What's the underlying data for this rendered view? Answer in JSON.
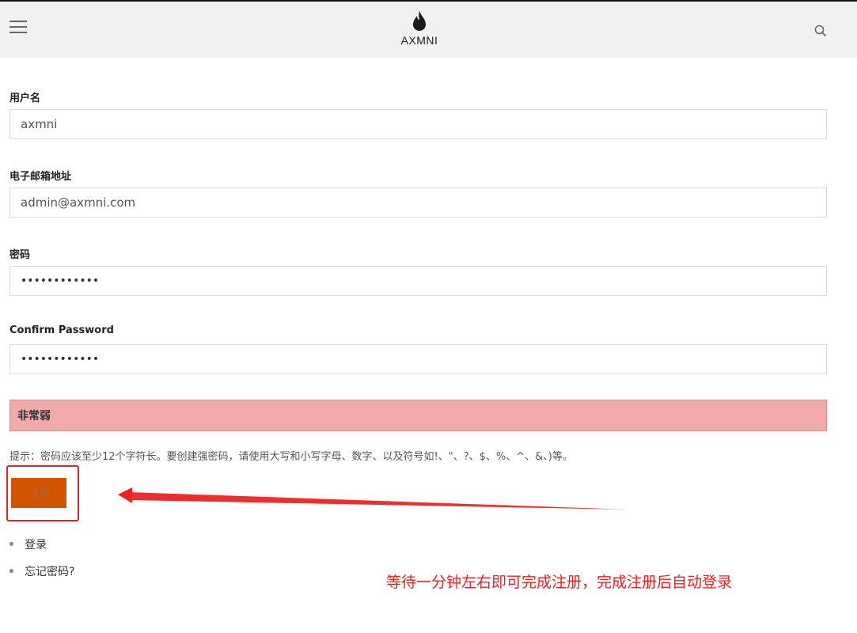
{
  "header": {
    "logo_text": "AXMNI",
    "menu_icon": "hamburger-menu-icon",
    "search_icon": "search-icon",
    "logo_icon": "flame-drop-icon"
  },
  "form": {
    "username": {
      "label": "用户名",
      "value": "axmni"
    },
    "email": {
      "label": "电子邮箱地址",
      "value": "admin@axmni.com"
    },
    "password": {
      "label": "密码",
      "value": "••••••••••••"
    },
    "confirm_password": {
      "label": "Confirm Password",
      "value": "••••••••••••"
    },
    "strength_text": "非常弱",
    "hint_text": "提示：密码应该至少12个字符长。要创建强密码，请使用大写和小写字母、数字、以及符号如!、\"、?、$、%、^、&、)等。",
    "submit_label": "注册"
  },
  "links": [
    {
      "label": "登录"
    },
    {
      "label": "忘记密码?"
    }
  ],
  "annotation": {
    "text": "等待一分钟左右即可完成注册，完成注册后自动登录",
    "color": "#ee2222"
  },
  "colors": {
    "header_bg": "#f1f1f1",
    "strength_bg": "#f1aaaa",
    "button_bg": "#d35400"
  }
}
